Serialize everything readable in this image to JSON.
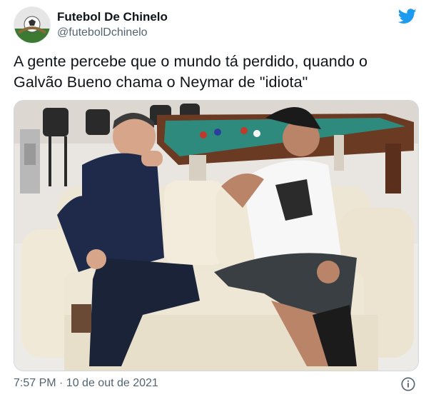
{
  "tweet": {
    "author_name": "Futebol De Chinelo",
    "author_handle": "@futebolDchinelo",
    "text_line1": "A gente percebe que o mundo tá perdido, quando o",
    "text_line2": "Galvão Bueno chama o Neymar de \"idiota\"",
    "timestamp": "7:57 PM · 10 de out de 2021"
  },
  "icons": {
    "brand": "twitter-bird-icon",
    "info": "info-icon"
  },
  "colors": {
    "brand_blue": "#1d9bf0",
    "secondary_text": "#536471",
    "primary_text": "#0f1419"
  }
}
